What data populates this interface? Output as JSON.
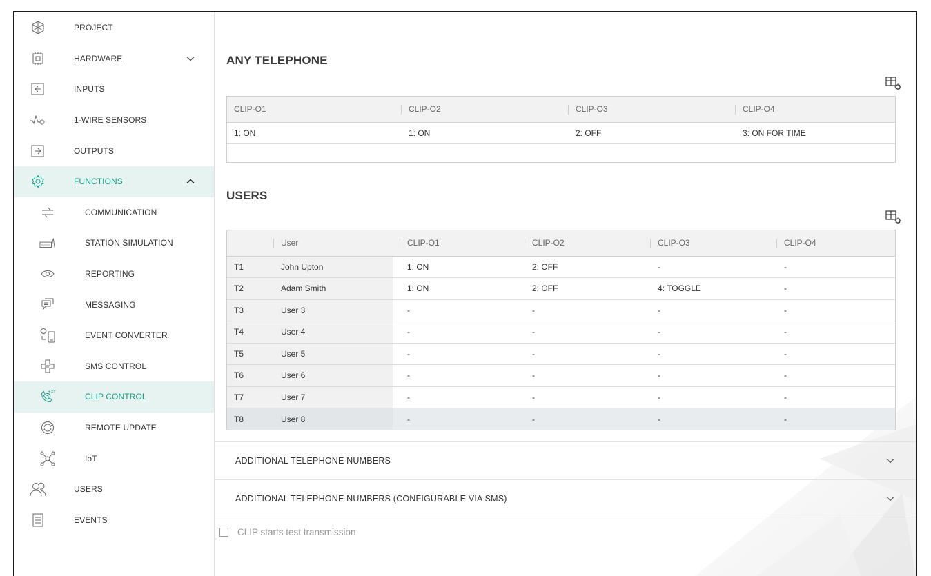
{
  "sidebar": {
    "items": [
      {
        "label": "PROJECT",
        "icon": "project-icon"
      },
      {
        "label": "HARDWARE",
        "icon": "hardware-icon",
        "chevron": "down"
      },
      {
        "label": "INPUTS",
        "icon": "inputs-icon"
      },
      {
        "label": "1-WIRE SENSORS",
        "icon": "sensor-icon"
      },
      {
        "label": "OUTPUTS",
        "icon": "outputs-icon"
      },
      {
        "label": "FUNCTIONS",
        "icon": "gear-icon",
        "chevron": "up",
        "active": true
      },
      {
        "label": "COMMUNICATION",
        "icon": "communication-icon",
        "sub": true
      },
      {
        "label": "STATION SIMULATION",
        "icon": "station-icon",
        "sub": true
      },
      {
        "label": "REPORTING",
        "icon": "eye-icon",
        "sub": true
      },
      {
        "label": "MESSAGING",
        "icon": "messaging-icon",
        "sub": true
      },
      {
        "label": "EVENT CONVERTER",
        "icon": "event-converter-icon",
        "sub": true
      },
      {
        "label": "SMS CONTROL",
        "icon": "sms-control-icon",
        "sub": true
      },
      {
        "label": "CLIP CONTROL",
        "icon": "phone-clip-icon",
        "sub": true,
        "active": true
      },
      {
        "label": "REMOTE UPDATE",
        "icon": "refresh-icon",
        "sub": true
      },
      {
        "label": "IoT",
        "icon": "iot-icon",
        "sub": true
      },
      {
        "label": "USERS",
        "icon": "users-icon"
      },
      {
        "label": "EVENTS",
        "icon": "events-icon"
      }
    ]
  },
  "any_telephone": {
    "title": "ANY TELEPHONE",
    "headers": [
      "CLIP-O1",
      "CLIP-O2",
      "CLIP-O3",
      "CLIP-O4"
    ],
    "rows": [
      [
        "1: ON",
        "1: ON",
        "2: OFF",
        "3: ON FOR TIME"
      ]
    ]
  },
  "users": {
    "title": "USERS",
    "headers": [
      "",
      "User",
      "CLIP-O1",
      "CLIP-O2",
      "CLIP-O3",
      "CLIP-O4"
    ],
    "rows": [
      [
        "T1",
        "John Upton",
        "1: ON",
        "2: OFF",
        "-",
        "-"
      ],
      [
        "T2",
        "Adam Smith",
        "1: ON",
        "2: OFF",
        "4: TOGGLE",
        "-"
      ],
      [
        "T3",
        "User 3",
        "-",
        "-",
        "-",
        "-"
      ],
      [
        "T4",
        "User 4",
        "-",
        "-",
        "-",
        "-"
      ],
      [
        "T5",
        "User 5",
        "-",
        "-",
        "-",
        "-"
      ],
      [
        "T6",
        "User 6",
        "-",
        "-",
        "-",
        "-"
      ],
      [
        "T7",
        "User 7",
        "-",
        "-",
        "-",
        "-"
      ],
      [
        "T8",
        "User 8",
        "-",
        "-",
        "-",
        "-"
      ]
    ]
  },
  "accordions": [
    {
      "label": "ADDITIONAL TELEPHONE NUMBERS"
    },
    {
      "label": "ADDITIONAL TELEPHONE NUMBERS (CONFIGURABLE VIA SMS)"
    }
  ],
  "checkbox": {
    "label": "CLIP starts test transmission",
    "checked": false
  },
  "colors": {
    "accent": "#1b9b86",
    "active_bg": "#e6f3f1",
    "header_bg": "#f2f2f2"
  }
}
